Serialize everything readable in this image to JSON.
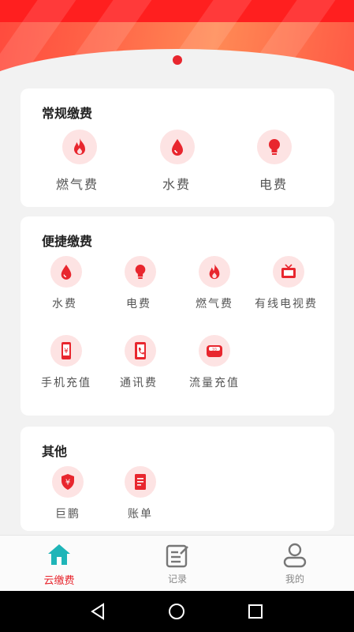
{
  "carousel": {
    "indicator_color": "#e8262e"
  },
  "sections": {
    "regular": {
      "title": "常规缴费",
      "items": [
        {
          "label": "燃气费",
          "icon": "flame-icon"
        },
        {
          "label": "水费",
          "icon": "water-drop-icon"
        },
        {
          "label": "电费",
          "icon": "lightbulb-icon"
        }
      ]
    },
    "quick": {
      "title": "便捷缴费",
      "items": [
        {
          "label": "水费",
          "icon": "water-drop-icon"
        },
        {
          "label": "电费",
          "icon": "lightbulb-icon"
        },
        {
          "label": "燃气费",
          "icon": "flame-icon"
        },
        {
          "label": "有线电视费",
          "icon": "tv-icon"
        },
        {
          "label": "手机充值",
          "icon": "phone-yuan-icon"
        },
        {
          "label": "通讯费",
          "icon": "phone-book-icon"
        },
        {
          "label": "流量充值",
          "icon": "data-pack-icon"
        }
      ]
    },
    "other": {
      "title": "其他",
      "items": [
        {
          "label": "巨鹏",
          "icon": "shield-yuan-icon"
        },
        {
          "label": "账单",
          "icon": "bill-icon"
        }
      ]
    }
  },
  "tabbar": {
    "items": [
      {
        "label": "云缴费",
        "icon": "home-icon",
        "active": true
      },
      {
        "label": "记录",
        "icon": "record-icon",
        "active": false
      },
      {
        "label": "我的",
        "icon": "user-icon",
        "active": false
      }
    ]
  },
  "colors": {
    "accent": "#e8262e",
    "icon_bg": "#fde3e3",
    "tab_active": "#e8262e",
    "home_icon": "#1fb5b8"
  }
}
